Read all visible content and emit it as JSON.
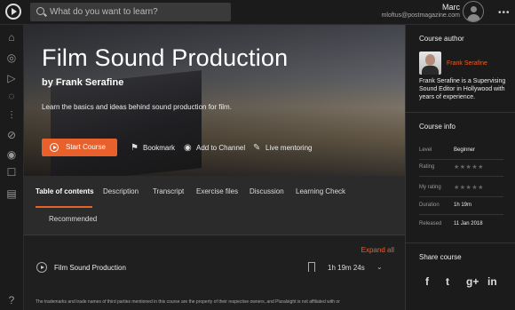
{
  "search": {
    "placeholder": "What do you want to learn?"
  },
  "user": {
    "name": "Marc",
    "email": "mloftus@postmagazine.com"
  },
  "course": {
    "title": "Film Sound Production",
    "author_line": "by Frank Serafine",
    "description": "Learn the basics and ideas behind sound production for film.",
    "start_label": "Start Course",
    "bookmark_label": "Bookmark",
    "add_channel_label": "Add to Channel",
    "mentoring_label": "Live mentoring"
  },
  "tabs": [
    {
      "label": "Table of contents"
    },
    {
      "label": "Description"
    },
    {
      "label": "Transcript"
    },
    {
      "label": "Exercise files"
    },
    {
      "label": "Discussion"
    },
    {
      "label": "Learning Check"
    },
    {
      "label": "Recommended"
    }
  ],
  "content": {
    "expand_label": "Expand all",
    "modules": [
      {
        "title": "Film Sound Production",
        "duration": "1h 19m 24s"
      }
    ],
    "disclaimer": "The trademarks and trade names of third parties mentioned in this course are the property of their respective owners, and Pluralsight is not affiliated with or"
  },
  "sidebar": {
    "author_heading": "Course author",
    "author_name": "Frank Serafine",
    "author_bio": "Frank Serafine is a Supervising Sound Editor in Hollywood with years of experience.",
    "info_heading": "Course info",
    "info": [
      {
        "label": "Level",
        "value": "Beginner"
      },
      {
        "label": "Rating",
        "value": "★★★★★"
      },
      {
        "label": "My rating",
        "value": "★★★★★"
      },
      {
        "label": "Duration",
        "value": "1h 19m"
      },
      {
        "label": "Released",
        "value": "11 Jan 2018"
      }
    ],
    "share_heading": "Share course",
    "share_icons": [
      "f",
      "t",
      "g+",
      "in"
    ]
  },
  "colors": {
    "accent": "#e8602c",
    "background": "#1b1b1b"
  },
  "icons": {
    "nav": [
      "home-icon",
      "skill-icon",
      "paths-icon",
      "channels-icon",
      "analytics-icon",
      "interactive-icon",
      "live-icon",
      "bookmarks-icon",
      "notes-icon",
      "help-icon"
    ]
  }
}
